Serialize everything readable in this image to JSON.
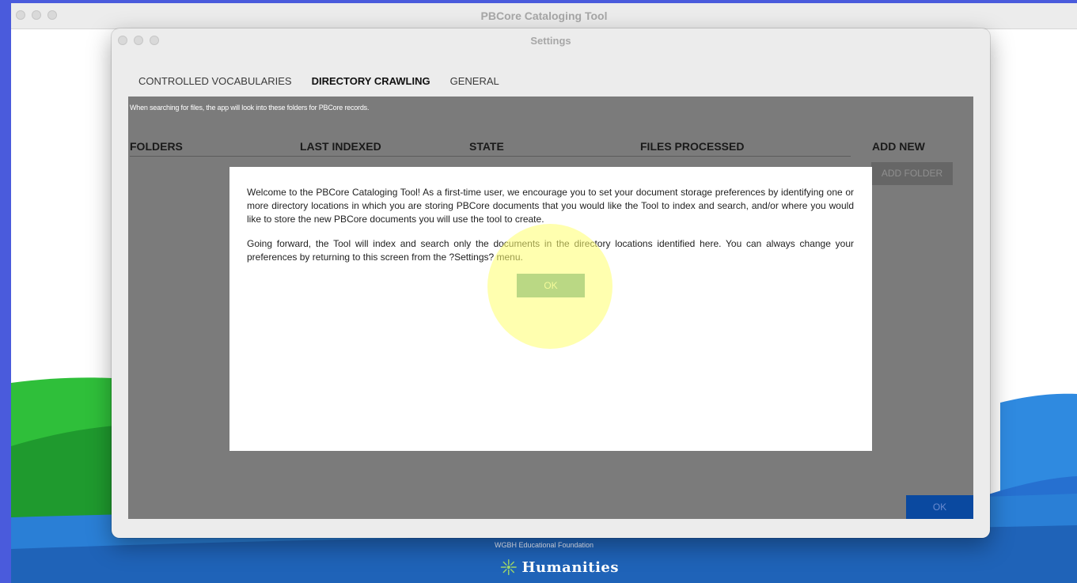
{
  "app": {
    "title": "PBCore Cataloging Tool"
  },
  "settings": {
    "title": "Settings",
    "tabs": [
      {
        "label": "CONTROLLED VOCABULARIES",
        "active": false
      },
      {
        "label": "DIRECTORY CRAWLING",
        "active": true
      },
      {
        "label": "GENERAL",
        "active": false
      }
    ],
    "hint": "When searching for files, the app will look into these folders for PBCore records.",
    "columns": [
      "FOLDERS",
      "LAST INDEXED",
      "STATE",
      "FILES PROCESSED"
    ],
    "add_new_label": "ADD NEW",
    "add_folder_button": "ADD FOLDER",
    "ok_button": "OK"
  },
  "dialog": {
    "paragraph1": "Welcome to the PBCore Cataloging Tool! As a first-time user, we encourage you to set your document storage preferences by identifying one or more directory locations in which you are storing PBCore documents that you would like the Tool to index and search, and/or where you would like to store the new PBCore documents you will use the tool to create.",
    "paragraph2": "Going forward, the Tool will index and search only the documents in the directory locations identified here. You can always change your preferences by returning to this screen from the ?Settings? menu.",
    "ok_button": "OK"
  },
  "footer": {
    "org": "WGBH Educational Foundation",
    "logo_text": "Humanities",
    "logo_icon": "sunburst-icon"
  },
  "colors": {
    "accent_ok": "#0a49a0",
    "dialog_ok": "#67a9a0",
    "panel_bg": "#7b7b7b",
    "highlight": "#ffff6e"
  }
}
